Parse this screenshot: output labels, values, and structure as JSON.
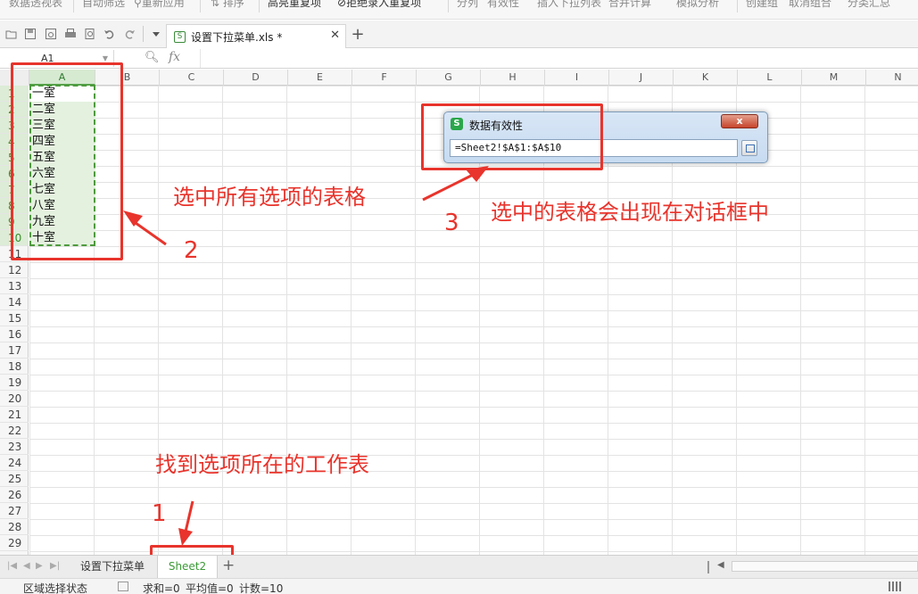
{
  "ribbon": {
    "items": [
      "数据透视表",
      "自动筛选",
      "重新应用",
      "排序",
      "高亮重复项",
      "拒绝录入重复项",
      "分列",
      "有效性",
      "插入下拉列表",
      "合并计算",
      "模拟分析",
      "创建组",
      "取消组合",
      "分类汇总"
    ]
  },
  "tabs": {
    "doc_name": "设置下拉菜单.xls *"
  },
  "formula_bar": {
    "cell_ref": "A1",
    "fx": "fx"
  },
  "columns": [
    "A",
    "B",
    "C",
    "D",
    "E",
    "F",
    "G",
    "H",
    "I",
    "J",
    "K",
    "L",
    "M",
    "N"
  ],
  "rows": [
    "1",
    "2",
    "3",
    "4",
    "5",
    "6",
    "7",
    "8",
    "9",
    "10",
    "11",
    "12",
    "13",
    "14",
    "15",
    "16",
    "17",
    "18",
    "19",
    "20",
    "21",
    "22",
    "23",
    "24",
    "25",
    "26",
    "27",
    "28",
    "29"
  ],
  "cells_A": [
    "一室",
    "二室",
    "三室",
    "四室",
    "五室",
    "六室",
    "七室",
    "八室",
    "九室",
    "十室"
  ],
  "dialog": {
    "title": "数据有效性",
    "reference": "=Sheet2!$A$1:$A$10",
    "close_label": "x"
  },
  "annotations": {
    "step1_text": "找到选项所在的工作表",
    "step1_num": "1",
    "step2_text": "选中所有选项的表格",
    "step2_num": "2",
    "step3_text": "选中的表格会出现在对话框中",
    "step3_num": "3",
    "color": "#e8342c"
  },
  "sheets": [
    "设置下拉菜单",
    "Sheet2"
  ],
  "active_sheet": "Sheet2",
  "status": {
    "mode": "区域选择状态",
    "sum": "求和=0",
    "avg": "平均值=0",
    "count": "计数=10"
  }
}
